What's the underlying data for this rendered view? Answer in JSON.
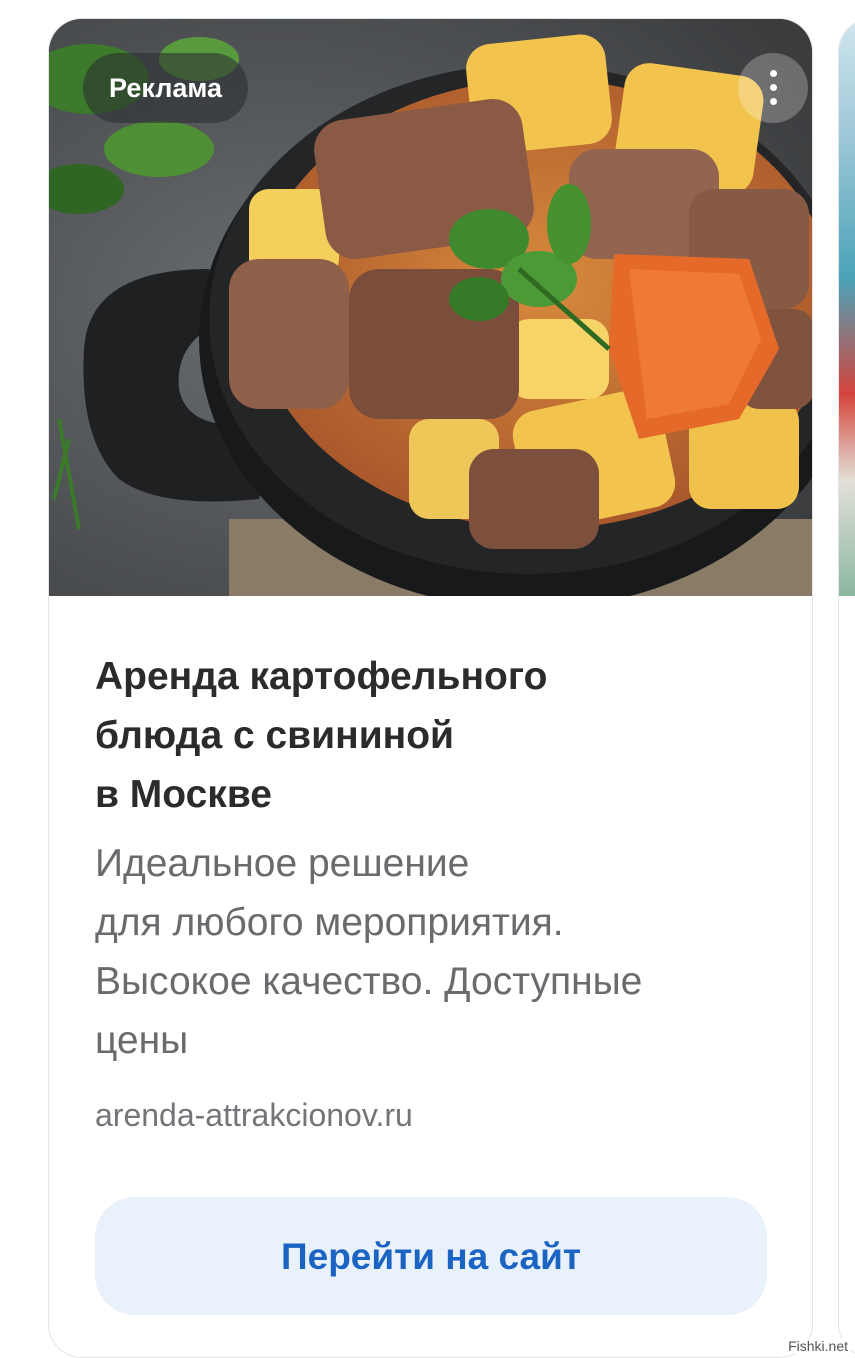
{
  "ad": {
    "badge": "Реклама",
    "title_lines": [
      "Аренда картофельного",
      "блюда с свининой",
      "в Москве"
    ],
    "description_lines": [
      "Идеальное решение",
      "для любого мероприятия.",
      "Высокое качество. Доступные",
      "цены"
    ],
    "domain": "arenda-attrakcionov.ru",
    "cta_label": "Перейти на сайт",
    "image": "stew-in-black-clay-pot"
  },
  "watermark": "Fishki.net",
  "colors": {
    "cta_background": "#e9f1fa",
    "cta_text": "#1c64c4",
    "title": "#2b2b2b",
    "description": "#6b6b6f"
  }
}
